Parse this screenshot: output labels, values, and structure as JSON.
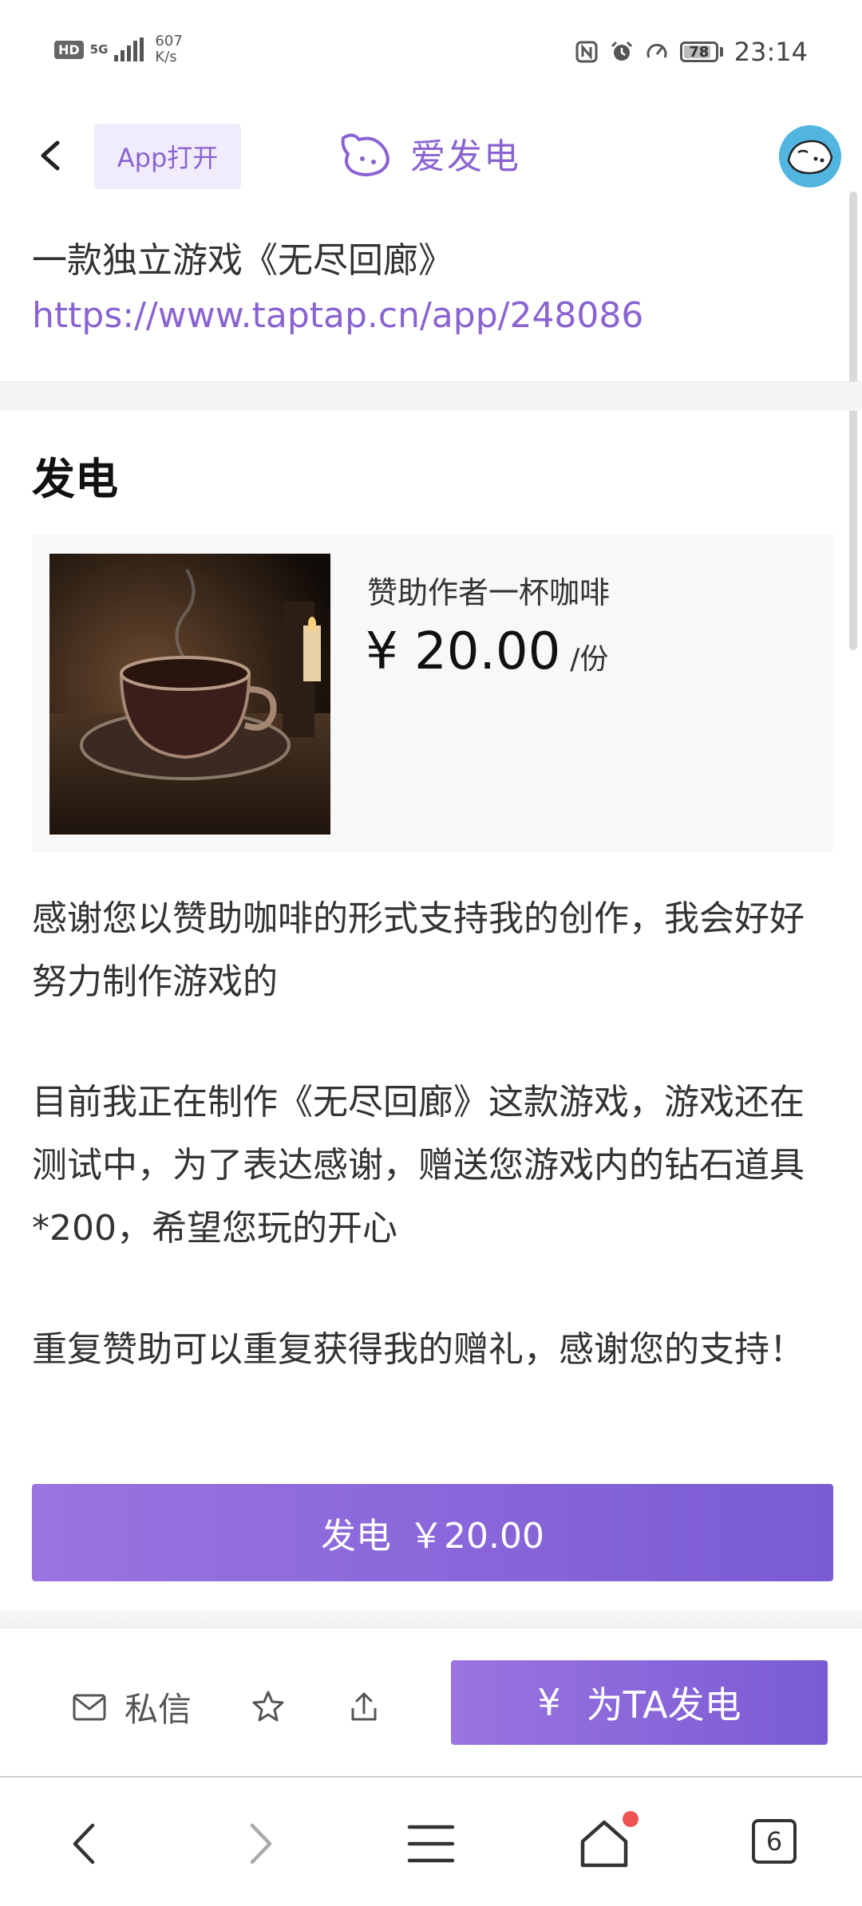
{
  "status_bar": {
    "hd": "HD",
    "network": "5G",
    "speed_value": "607",
    "speed_unit": "K/s",
    "battery": "78",
    "time": "23:14"
  },
  "header": {
    "app_open_label": "App打开",
    "brand_name": "爱发电"
  },
  "intro": {
    "title": "一款独立游戏《无尽回廊》",
    "link": "https://www.taptap.cn/app/248086"
  },
  "donate": {
    "section_title": "发电",
    "product": {
      "name": "赞助作者一杯咖啡",
      "price": "¥ 20.00",
      "unit": "/份"
    },
    "description": [
      "感谢您以赞助咖啡的形式支持我的创作，我会好好努力制作游戏的",
      "目前我正在制作《无尽回廊》这款游戏，游戏还在测试中，为了表达感谢，赠送您游戏内的钻石道具*200，希望您玩的开心",
      "重复赞助可以重复获得我的赠礼，感谢您的支持！"
    ],
    "button_label": "发电",
    "button_price": "￥20.00"
  },
  "action_bar": {
    "message_label": "私信",
    "charge_symbol": "¥",
    "charge_label": "为TA发电"
  },
  "browser_nav": {
    "tab_count": "6"
  },
  "colors": {
    "accent": "#8a63d2",
    "button_gradient_start": "#9a74e0",
    "button_gradient_end": "#7a5bd4",
    "notification_dot": "#ef5350"
  }
}
